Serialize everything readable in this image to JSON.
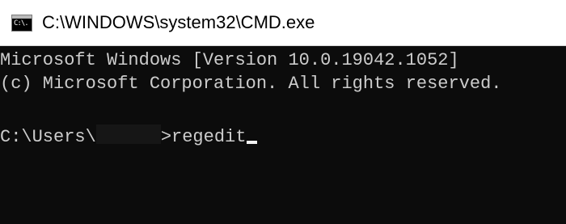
{
  "window": {
    "title": "C:\\WINDOWS\\system32\\CMD.exe",
    "icon": "cmd-app-icon",
    "icon_glyph": "C:\\."
  },
  "console": {
    "line1": "Microsoft Windows [Version 10.0.19042.1052]",
    "line2": "(c) Microsoft Corporation. All rights reserved.",
    "prompt_prefix": "C:\\Users\\",
    "prompt_suffix": ">",
    "command": "regedit"
  },
  "colors": {
    "titlebar_bg": "#ffffff",
    "console_bg": "#0c0c0c",
    "console_text": "#cccccc",
    "cursor": "#f2f2f2"
  }
}
